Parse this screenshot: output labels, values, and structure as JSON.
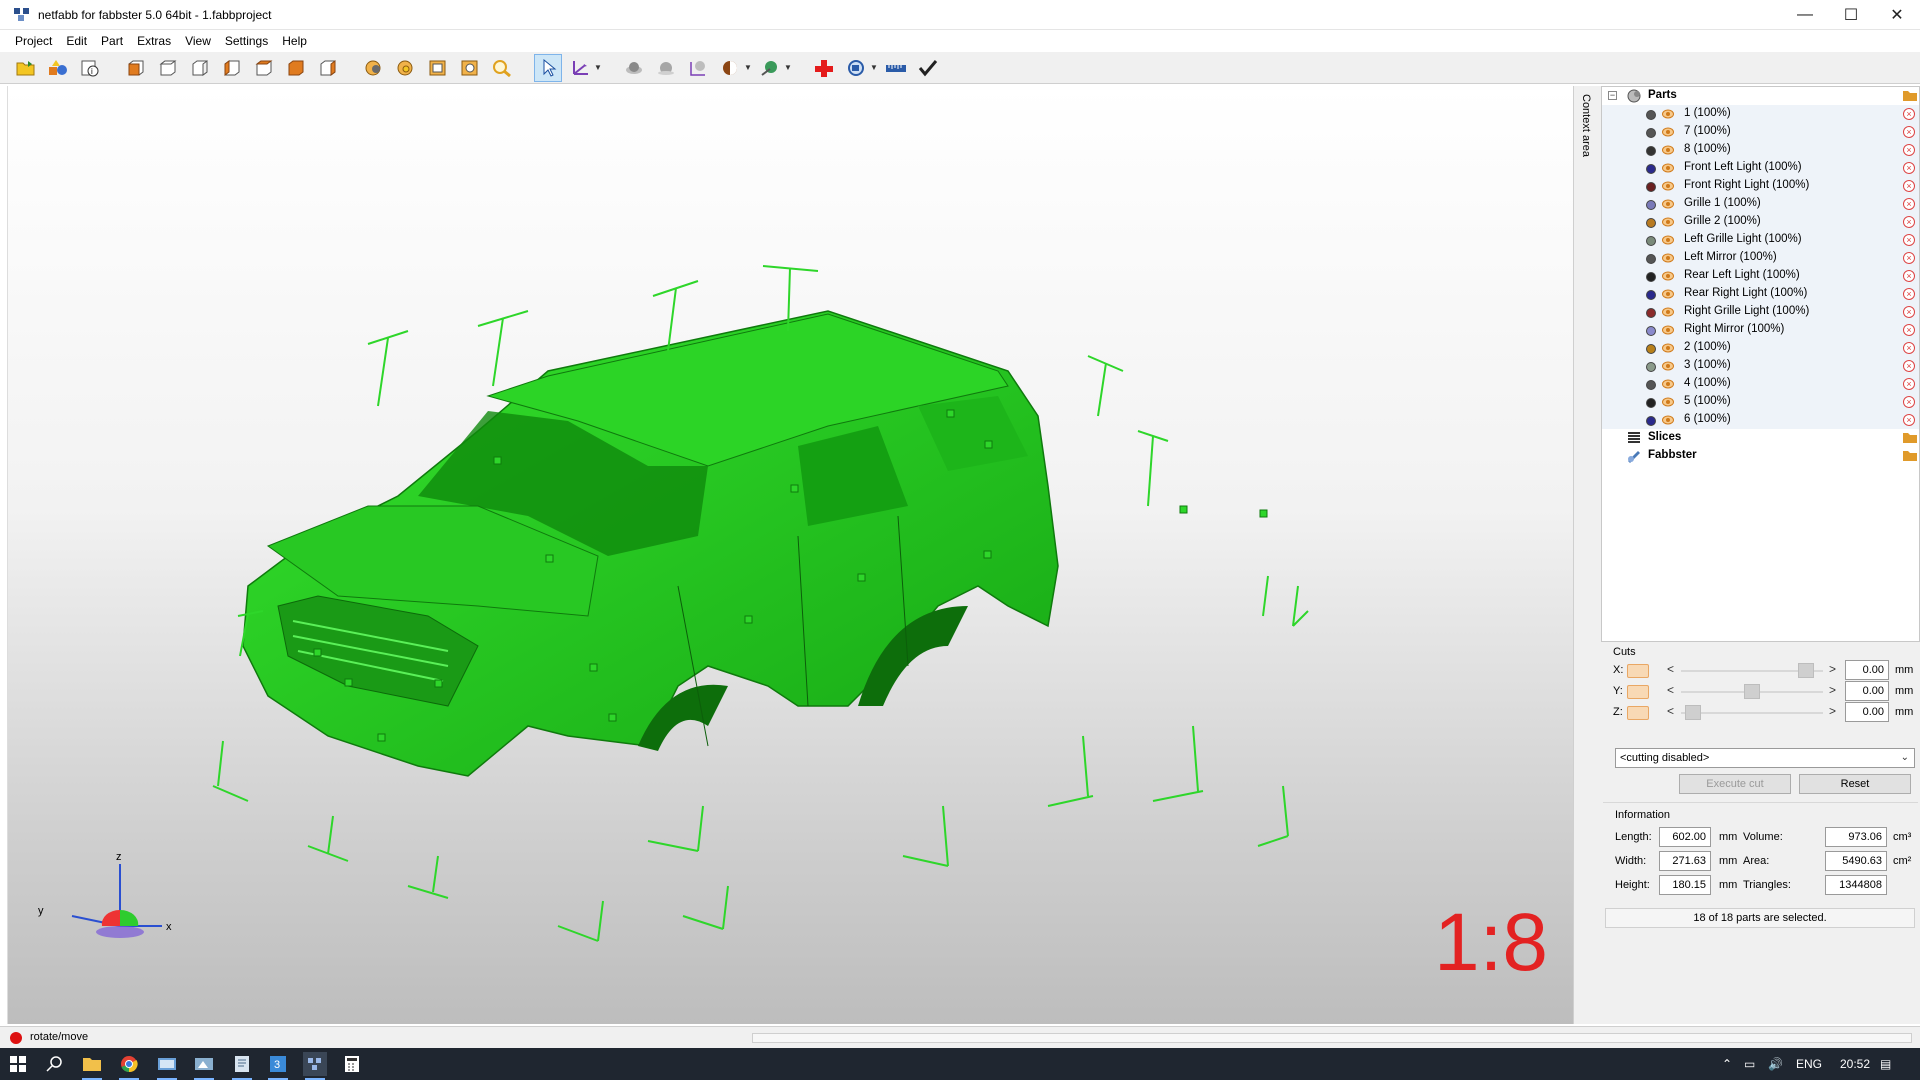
{
  "window": {
    "title": "netfabb for fabbster 5.0 64bit - 1.fabbproject",
    "controls": [
      "minimize",
      "maximize",
      "close"
    ]
  },
  "menu": [
    "Project",
    "Edit",
    "Part",
    "Extras",
    "View",
    "Settings",
    "Help"
  ],
  "toolbar_icons": [
    "open-project-icon",
    "add-part-icon",
    "project-info-icon",
    "view-front-icon",
    "view-back-icon",
    "view-left-icon",
    "view-right-icon",
    "view-top-icon",
    "view-bottom-icon",
    "view-perspective-icon",
    "zoom-part-icon",
    "zoom-all-icon",
    "zoom-fit-icon",
    "zoom-window-icon",
    "zoom-icon",
    "select-cursor-icon",
    "move-axis-icon",
    "shading-icon",
    "smooth-icon",
    "measure-icon",
    "color-icon",
    "wizard-icon",
    "repair-icon",
    "analysis-icon",
    "ruler-icon",
    "check-icon"
  ],
  "viewport": {
    "scale_label": "1:8",
    "model_color": "#22d11e",
    "axis_labels": {
      "x": "x",
      "y": "y",
      "z": "z"
    }
  },
  "context_area": {
    "label": "Context area"
  },
  "tree": {
    "root": "Parts",
    "parts": [
      {
        "name": "1 (100%)",
        "color": "#555555"
      },
      {
        "name": "7 (100%)",
        "color": "#555555"
      },
      {
        "name": "8 (100%)",
        "color": "#333333"
      },
      {
        "name": "Front Left Light (100%)",
        "color": "#2a2a8c"
      },
      {
        "name": "Front Right Light (100%)",
        "color": "#6a2020"
      },
      {
        "name": "Grille 1 (100%)",
        "color": "#7a7ab8"
      },
      {
        "name": "Grille 2 (100%)",
        "color": "#b87a20"
      },
      {
        "name": "Left Grille Light (100%)",
        "color": "#7a8a7a"
      },
      {
        "name": "Left Mirror (100%)",
        "color": "#555555"
      },
      {
        "name": "Rear Left Light (100%)",
        "color": "#222222"
      },
      {
        "name": "Rear Right Light (100%)",
        "color": "#2a2a8c"
      },
      {
        "name": "Right Grille Light (100%)",
        "color": "#8a2a2a"
      },
      {
        "name": "Right Mirror (100%)",
        "color": "#8a8acc"
      },
      {
        "name": "2 (100%)",
        "color": "#b8801a"
      },
      {
        "name": "3 (100%)",
        "color": "#8a9a8a"
      },
      {
        "name": "4 (100%)",
        "color": "#555555"
      },
      {
        "name": "5 (100%)",
        "color": "#222222"
      },
      {
        "name": "6 (100%)",
        "color": "#2a2a8c"
      }
    ],
    "slices": "Slices",
    "fabbster": "Fabbster"
  },
  "cuts": {
    "title": "Cuts",
    "rows": [
      {
        "axis": "X:",
        "value": "0.00",
        "unit": "mm",
        "slider_fraction": 0.93
      },
      {
        "axis": "Y:",
        "value": "0.00",
        "unit": "mm",
        "slider_fraction": 0.5
      },
      {
        "axis": "Z:",
        "value": "0.00",
        "unit": "mm",
        "slider_fraction": 0.03
      }
    ],
    "mode": "<cutting disabled>",
    "execute_label": "Execute cut",
    "reset_label": "Reset"
  },
  "information": {
    "title": "Information",
    "length_label": "Length:",
    "length": "602.00",
    "length_unit": "mm",
    "width_label": "Width:",
    "width": "271.63",
    "width_unit": "mm",
    "height_label": "Height:",
    "height": "180.15",
    "height_unit": "mm",
    "volume_label": "Volume:",
    "volume": "973.06",
    "volume_unit": "cm³",
    "area_label": "Area:",
    "area": "5490.63",
    "area_unit": "cm²",
    "triangles_label": "Triangles:",
    "triangles": "1344808",
    "selection": "18 of 18 parts are selected."
  },
  "status": {
    "mode": "rotate/move"
  },
  "taskbar": {
    "apps": [
      "start-icon",
      "search-icon",
      "file-explorer-icon",
      "chrome-icon",
      "app-icon-1",
      "app-icon-2",
      "app-icon-3",
      "app-icon-4",
      "netfabb-icon",
      "calculator-icon"
    ],
    "language": "ENG",
    "time": "20:52"
  }
}
